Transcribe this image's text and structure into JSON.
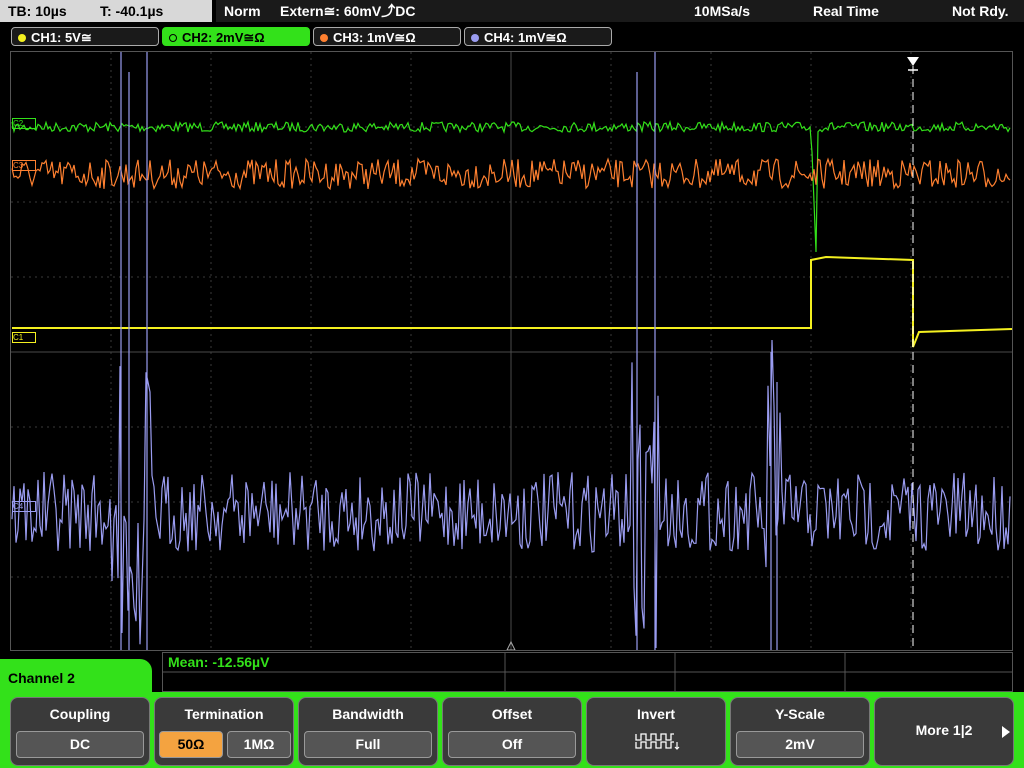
{
  "status": {
    "timebase": "TB: 10µs",
    "trigger_time": "T: -40.1µs",
    "mode": "Norm",
    "trigger": "Extern≅: 60mV⤴DC",
    "sample_rate": "10MSa/s",
    "acq_mode": "Real Time",
    "ready_state": "Not Rdy."
  },
  "channels": [
    {
      "label": "CH1: 5V≅",
      "color": "#f4f020"
    },
    {
      "label": "CH2: 2mV≅Ω",
      "color": "#33e11a",
      "active": true
    },
    {
      "label": "CH3: 1mV≅Ω",
      "color": "#ff8030"
    },
    {
      "label": "CH4: 1mV≅Ω",
      "color": "#9a9cf0"
    }
  ],
  "markers": {
    "c1": "C1",
    "c2": "C2",
    "c3": "C3",
    "c4": "C4"
  },
  "measurement": {
    "text": "Mean: -12.56µV"
  },
  "channel_menu": {
    "title": "Channel 2"
  },
  "softkeys": {
    "coupling": {
      "title": "Coupling",
      "value": "DC"
    },
    "termination": {
      "title": "Termination",
      "opt1": "50Ω",
      "opt2": "1MΩ"
    },
    "bandwidth": {
      "title": "Bandwidth",
      "value": "Full"
    },
    "offset": {
      "title": "Offset",
      "value": "Off"
    },
    "invert": {
      "title": "Invert"
    },
    "yscale": {
      "title": "Y-Scale",
      "value": "2mV"
    },
    "more": {
      "label": "More 1|2"
    }
  }
}
